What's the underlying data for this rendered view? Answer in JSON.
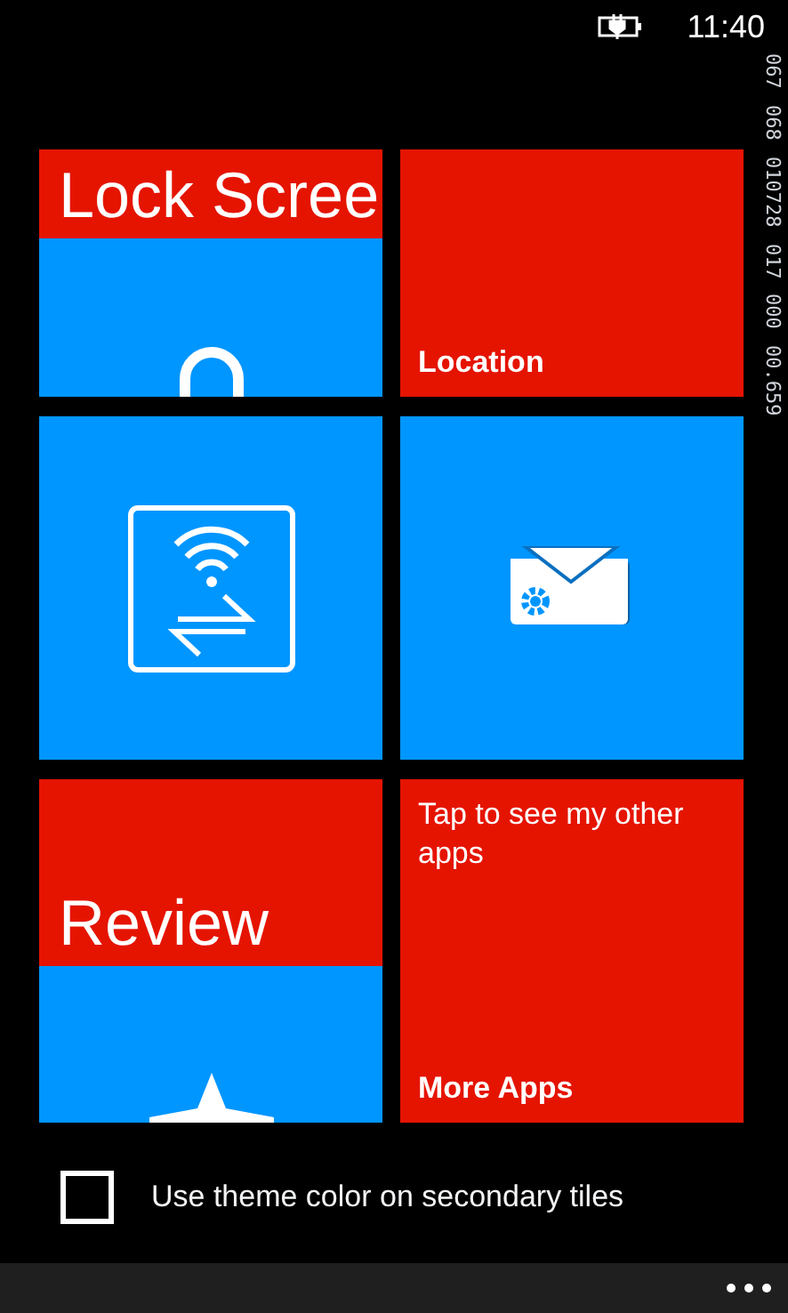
{
  "status_bar": {
    "time": "11:40"
  },
  "debug_counters": [
    "067",
    "068",
    "010728",
    "017",
    "000",
    "00.659"
  ],
  "tiles": [
    {
      "kind": "banner",
      "title": "Lock Scree"
    },
    {
      "kind": "label",
      "label": "Location"
    },
    {
      "kind": "icon"
    },
    {
      "kind": "icon"
    },
    {
      "kind": "banner",
      "title": "Review"
    },
    {
      "kind": "text",
      "text": "Tap to see my other apps",
      "label": "More Apps"
    }
  ],
  "theme_option": {
    "label": "Use theme color on secondary tiles",
    "checked": false
  }
}
